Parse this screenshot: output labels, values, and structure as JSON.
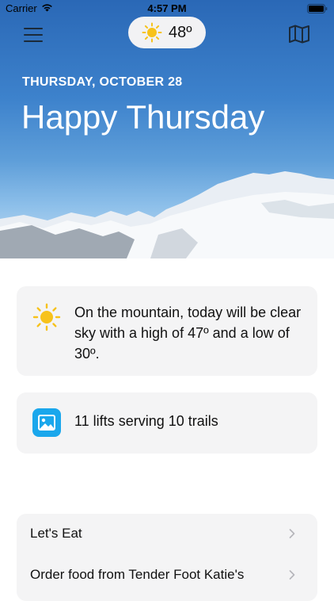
{
  "status_bar": {
    "carrier": "Carrier",
    "time": "4:57 PM"
  },
  "header": {
    "temperature": "48º",
    "icons": [
      "hamburger-menu-icon",
      "sun-icon",
      "map-icon"
    ]
  },
  "hero": {
    "date": "THURSDAY, OCTOBER 28",
    "greeting": "Happy Thursday"
  },
  "weather_card": {
    "text": "On the mountain, today will be clear sky with a high of 47º and a low of 30º.",
    "icon": "sun-icon"
  },
  "lifts_card": {
    "text": "11 lifts serving 10 trails",
    "icon": "photo-icon"
  },
  "food_card": {
    "items": [
      {
        "label": "Let's Eat"
      },
      {
        "label": "Order food from Tender Foot Katie's"
      }
    ]
  },
  "colors": {
    "sun": "#f7c21a",
    "photo_icon": "#1aa7ec",
    "card_bg": "#f4f4f5",
    "sky": "#3d82cc"
  }
}
